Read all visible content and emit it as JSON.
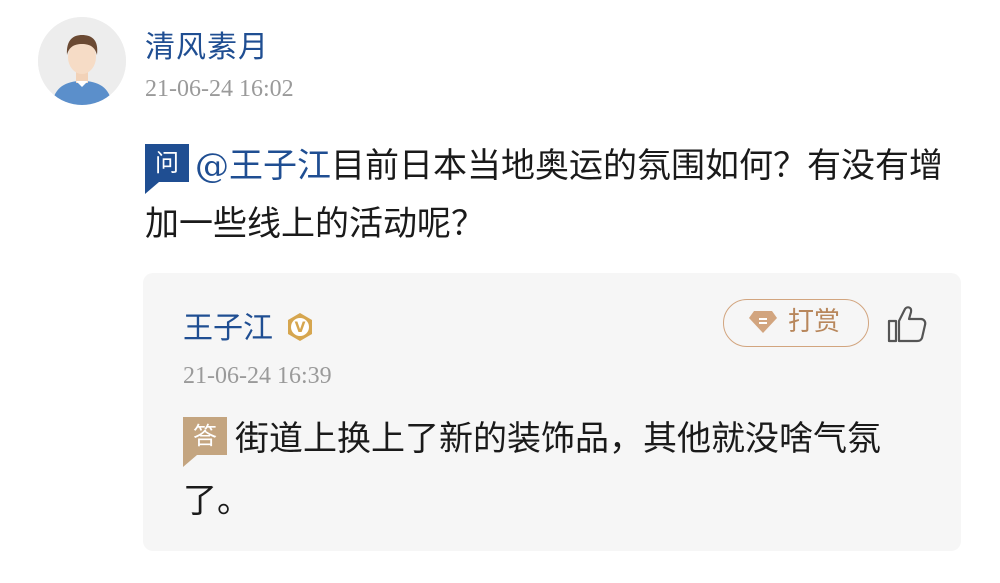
{
  "question": {
    "user_name": "清风素月",
    "timestamp": "21-06-24 16:02",
    "badge": "问",
    "mention": "@王子江",
    "text": "目前日本当地奥运的氛围如何？有没有增加一些线上的活动呢？"
  },
  "reply": {
    "user_name": "王子江",
    "verified_badge_letter": "V",
    "tip_label": "打赏",
    "timestamp": "21-06-24 16:39",
    "badge": "答",
    "text": "街道上换上了新的装饰品，其他就没啥气氛了。"
  },
  "icons": {
    "avatar": "default-user-avatar",
    "verified": "verified-v-badge-icon",
    "tip": "gem-icon",
    "like": "thumbs-up-icon"
  },
  "colors": {
    "name_blue": "#1f4e92",
    "timestamp_gray": "#9a9a9a",
    "answer_badge": "#c4a580",
    "tip_border": "#d2a57f",
    "card_bg": "#f6f6f6"
  }
}
